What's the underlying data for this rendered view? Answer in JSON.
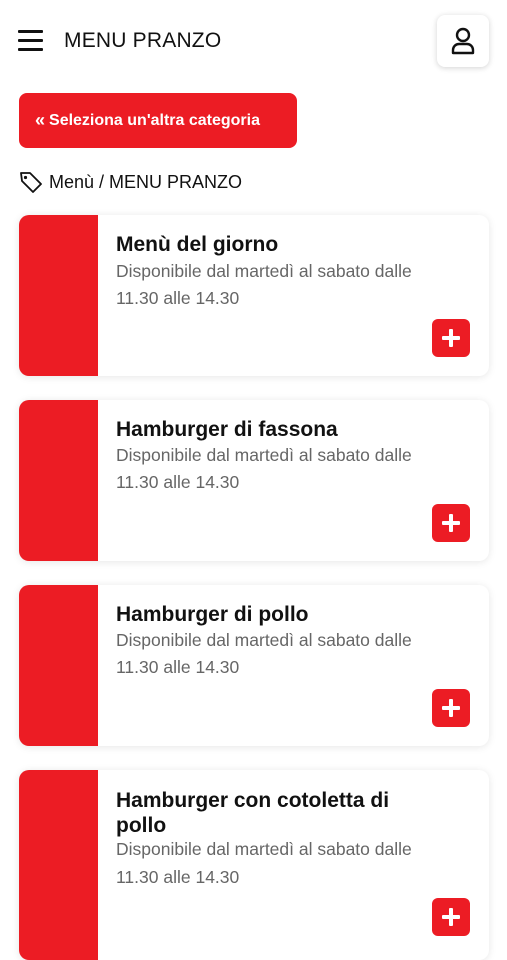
{
  "header": {
    "title": "MENU PRANZO",
    "menu_icon": "hamburger-menu-icon",
    "user_icon": "user-icon"
  },
  "back_button": {
    "icon": "double-chevron-left-icon",
    "label": "Seleziona un'altra categoria"
  },
  "breadcrumb": {
    "icon": "tag-icon",
    "text": "Menù / MENU PRANZO"
  },
  "products": [
    {
      "title": "Menù del giorno",
      "desc_line1": "Disponibile dal martedì al sabato dalle",
      "desc_line2": "11.30 alle 14.30",
      "add_icon": "plus-icon"
    },
    {
      "title": "Hamburger di fassona",
      "desc_line1": "Disponibile dal martedì al sabato dalle",
      "desc_line2": "11.30 alle 14.30",
      "add_icon": "plus-icon"
    },
    {
      "title": "Hamburger di pollo",
      "desc_line1": "Disponibile dal martedì al sabato dalle",
      "desc_line2": "11.30 alle 14.30",
      "add_icon": "plus-icon"
    },
    {
      "title_line1": "Hamburger con cotoletta di",
      "title_line2": "pollo",
      "desc_line1": "Disponibile dal martedì al sabato dalle",
      "desc_line2": "11.30 alle 14.30",
      "add_icon": "plus-icon"
    }
  ],
  "colors": {
    "accent": "#ec1c24",
    "text": "#111111",
    "muted": "#666666"
  }
}
